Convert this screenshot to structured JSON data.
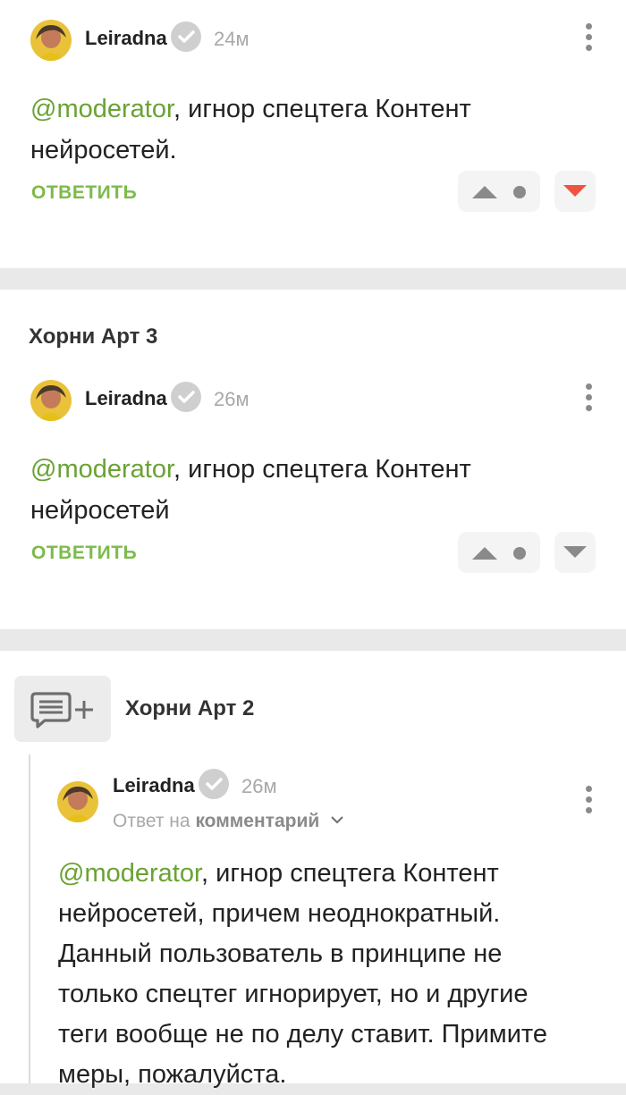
{
  "comments": [
    {
      "author": "Leiradna",
      "time": "24м",
      "mention": "@moderator",
      "text_line1": ", игнор спецтега Контент",
      "text_line2": "нейросетей.",
      "reply_label": "ОТВЕТИТЬ",
      "downvote_active": true
    },
    {
      "post_title": "Хорни Арт 3",
      "author": "Leiradna",
      "time": "26м",
      "mention": "@moderator",
      "text_line1": ", игнор спецтега Контент",
      "text_line2": "нейросетей",
      "reply_label": "ОТВЕТИТЬ",
      "downvote_active": false
    },
    {
      "post_title": "Хорни Арт 2",
      "author": "Leiradna",
      "time": "26м",
      "reply_to_prefix": "Ответ на",
      "reply_to_link": "комментарий",
      "mention": "@moderator",
      "text_line1": ", игнор спецтега Контент",
      "text_lines": [
        "нейросетей, причем неоднократный.",
        "Данный пользователь в принципе не",
        "только спецтег игнорирует, но и другие",
        "теги вообще не по делу ставит. Примите",
        "меры, пожалуйста."
      ]
    }
  ],
  "colors": {
    "accent_green": "#7cbb4a",
    "mention_green": "#6aa234",
    "downvote_red": "#f0533f",
    "vote_gray": "#8a8a8a"
  },
  "icons": {
    "verified": "checkmark-badge-icon",
    "menu": "kebab-menu-icon",
    "upvote": "triangle-up-icon",
    "downvote": "triangle-down-icon",
    "add_comment": "comment-plus-icon"
  }
}
